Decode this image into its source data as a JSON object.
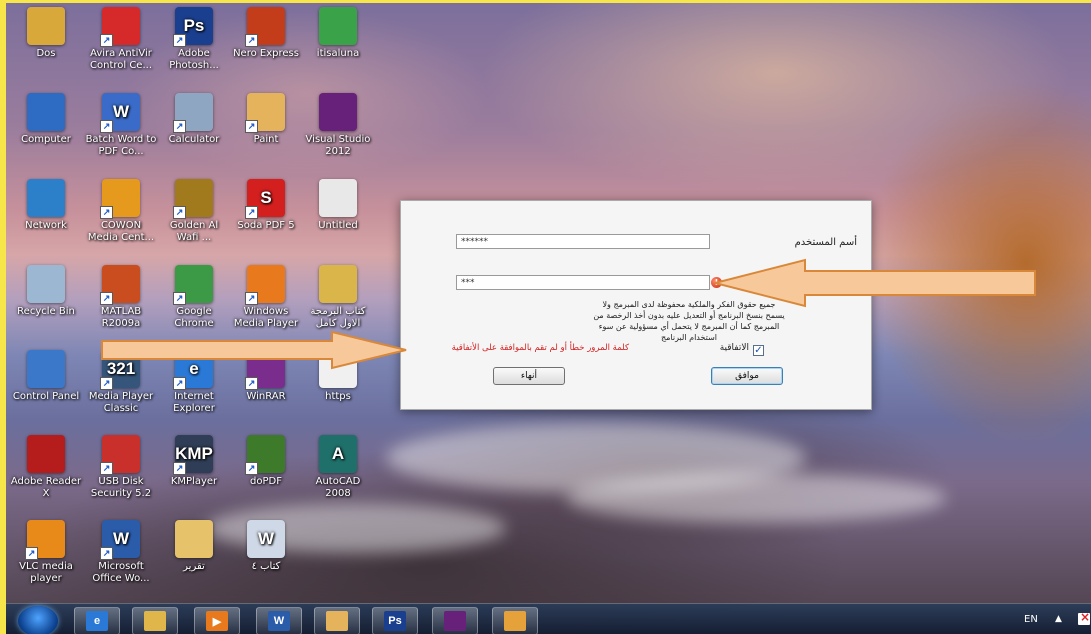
{
  "desktop": {
    "icons": [
      {
        "label": "Dos",
        "icon": "folder-icon",
        "color": "#d9a83a",
        "glyph": "",
        "shortcut": false
      },
      {
        "label": "Avira AntiVir Control Ce...",
        "icon": "avira-icon",
        "color": "#d62a2a",
        "glyph": "",
        "shortcut": true
      },
      {
        "label": "Adobe Photosh...",
        "icon": "photoshop-icon",
        "color": "#1b3f8f",
        "glyph": "Ps",
        "shortcut": true
      },
      {
        "label": "Nero Express",
        "icon": "nero-icon",
        "color": "#c43d1a",
        "glyph": "",
        "shortcut": true
      },
      {
        "label": "itisaluna",
        "icon": "itisaluna-icon",
        "color": "#3aa34a",
        "glyph": "",
        "shortcut": false
      },
      {
        "label": "Computer",
        "icon": "computer-icon",
        "color": "#2e6bc2",
        "glyph": "",
        "shortcut": false
      },
      {
        "label": "Batch Word to PDF Co...",
        "icon": "word-pdf-icon",
        "color": "#3a6bc8",
        "glyph": "W",
        "shortcut": true
      },
      {
        "label": "Calculator",
        "icon": "calculator-icon",
        "color": "#8fa6c2",
        "glyph": "",
        "shortcut": true
      },
      {
        "label": "Paint",
        "icon": "paint-icon",
        "color": "#e5b35c",
        "glyph": "",
        "shortcut": true
      },
      {
        "label": "Visual Studio 2012",
        "icon": "visual-studio-icon",
        "color": "#68217a",
        "glyph": "",
        "shortcut": false
      },
      {
        "label": "Network",
        "icon": "network-icon",
        "color": "#2c7fc9",
        "glyph": "",
        "shortcut": false
      },
      {
        "label": "COWON Media Cent...",
        "icon": "cowon-icon",
        "color": "#e59a1d",
        "glyph": "",
        "shortcut": true
      },
      {
        "label": "Golden Al Wafi ...",
        "icon": "golden-alwafi-icon",
        "color": "#a07a1c",
        "glyph": "",
        "shortcut": true
      },
      {
        "label": "Soda PDF 5",
        "icon": "soda-pdf-icon",
        "color": "#d41f1f",
        "glyph": "S",
        "shortcut": true
      },
      {
        "label": "Untitled",
        "icon": "document-icon",
        "color": "#e8e8e8",
        "glyph": "",
        "shortcut": false
      },
      {
        "label": "Recycle Bin",
        "icon": "recycle-bin-icon",
        "color": "#9bb7d1",
        "glyph": "",
        "shortcut": false
      },
      {
        "label": "MATLAB R2009a",
        "icon": "matlab-icon",
        "color": "#c94d1f",
        "glyph": "",
        "shortcut": true
      },
      {
        "label": "Google Chrome",
        "icon": "chrome-icon",
        "color": "#3c9a47",
        "glyph": "",
        "shortcut": true
      },
      {
        "label": "Windows Media Player",
        "icon": "media-player-icon",
        "color": "#e8791c",
        "glyph": "",
        "shortcut": true
      },
      {
        "label": "كتاب البرمجة الاول كامل",
        "icon": "folder-icon",
        "color": "#d9b54a",
        "glyph": "",
        "shortcut": false
      },
      {
        "label": "Control Panel",
        "icon": "control-panel-icon",
        "color": "#3b78c9",
        "glyph": "",
        "shortcut": false
      },
      {
        "label": "Media Player Classic",
        "icon": "media-player-classic-icon",
        "color": "#35557a",
        "glyph": "321",
        "shortcut": true
      },
      {
        "label": "Internet Explorer",
        "icon": "internet-explorer-icon",
        "color": "#2a79d6",
        "glyph": "e",
        "shortcut": true
      },
      {
        "label": "WinRAR",
        "icon": "winrar-icon",
        "color": "#7a2d8c",
        "glyph": "",
        "shortcut": true
      },
      {
        "label": "https",
        "icon": "document-icon",
        "color": "#f0f0f0",
        "glyph": "",
        "shortcut": false
      },
      {
        "label": "Adobe Reader X",
        "icon": "adobe-reader-icon",
        "color": "#b51c1c",
        "glyph": "",
        "shortcut": false
      },
      {
        "label": "USB Disk Security 5.2",
        "icon": "usb-disk-security-icon",
        "color": "#c9302c",
        "glyph": "",
        "shortcut": true
      },
      {
        "label": "KMPlayer",
        "icon": "kmplayer-icon",
        "color": "#2f3e56",
        "glyph": "KMP",
        "shortcut": true
      },
      {
        "label": "doPDF",
        "icon": "dopdf-icon",
        "color": "#3d7a2a",
        "glyph": "",
        "shortcut": true
      },
      {
        "label": "AutoCAD 2008",
        "icon": "autocad-icon",
        "color": "#1f6f6a",
        "glyph": "A",
        "shortcut": false
      },
      {
        "label": "VLC media player",
        "icon": "vlc-icon",
        "color": "#e88a1a",
        "glyph": "",
        "shortcut": true
      },
      {
        "label": "Microsoft Office Wo...",
        "icon": "word-icon",
        "color": "#2a5caa",
        "glyph": "W",
        "shortcut": true
      },
      {
        "label": "تقرير",
        "icon": "word-document-icon",
        "color": "#e6c36b",
        "glyph": "",
        "shortcut": false
      },
      {
        "label": "كتاب ٤",
        "icon": "word-document-icon",
        "color": "#cfd8e6",
        "glyph": "W",
        "shortcut": false
      }
    ]
  },
  "dialog": {
    "username_label": "أسم المستخدم",
    "username_value": "******",
    "password_value": "***",
    "notice": "جميع حقوق الفكر والملكية محفوظة لدى المبرمج ولا يسمح بنسخ البرنامج أو التعديل عليه بدون أخذ الرخصة من المبرمج كما أن المبرمج لا يتحمل أي مسؤولية عن سوء استخدام البرنامج",
    "error_message": "كلمة المرور خطأ أو لم تقم بالموافقة على الأتفاقية",
    "agreement_label": "الاتفاقية",
    "agreement_checked": true,
    "ok_button": "موافق",
    "exit_button": "أنهاء",
    "error_icon": "error-icon"
  },
  "colors": {
    "arrow_fill": "#f7c99a",
    "arrow_stroke": "#d9883a",
    "error_text": "#d31f1f"
  },
  "taskbar": {
    "items": [
      {
        "icon": "internet-explorer-icon",
        "glyph": "e"
      },
      {
        "icon": "file-explorer-icon",
        "glyph": ""
      },
      {
        "icon": "media-player-icon",
        "glyph": "▶"
      },
      {
        "icon": "word-icon",
        "glyph": "W"
      },
      {
        "icon": "paint-icon",
        "glyph": ""
      },
      {
        "icon": "photoshop-icon",
        "glyph": "Ps"
      },
      {
        "icon": "visual-studio-icon",
        "glyph": ""
      },
      {
        "icon": "app-window-icon",
        "glyph": ""
      }
    ],
    "language": "EN"
  }
}
